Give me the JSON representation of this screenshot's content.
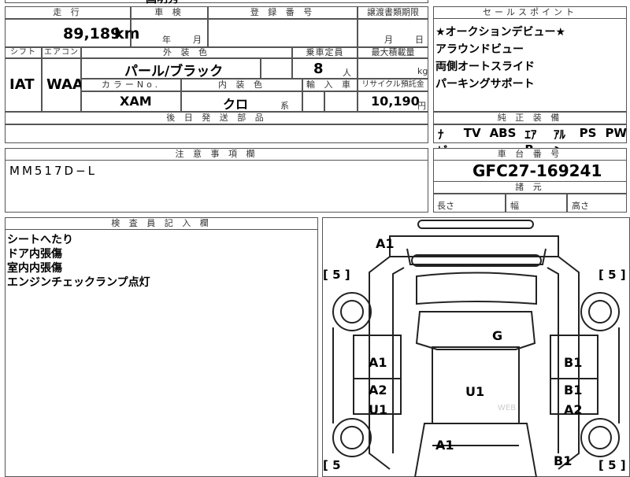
{
  "top_fragment": "国明秀",
  "headers": {
    "mileage": "走 行",
    "inspection": "車 検",
    "registration": "登 録 番 号",
    "transfer_deadline": "譲渡書類期限",
    "sales_point": "セールスポイント",
    "shift": "シフト",
    "aircon": "エアコン",
    "exterior": "外 装 色",
    "capacity": "乗車定員",
    "max_load": "最大積載量",
    "color_no": "カラーNo.",
    "interior": "内 装 色",
    "import": "輸 入 車",
    "recycle": "リサイクル預託金",
    "later_parts": "後 日 発 送 部 品",
    "options": "純 正 装 備",
    "notes": "注 意 事 項 欄",
    "chassis_no": "車 台 番 号",
    "dimensions": "諸 元",
    "inspector": "検 査 員 記 入 欄"
  },
  "values": {
    "mileage": "89,189",
    "mileage_unit": "km",
    "inspection_year": "年",
    "inspection_month": "月",
    "transfer_month": "月",
    "transfer_day": "日",
    "shift": "IAT",
    "aircon": "WAA",
    "exterior": "パール/ブラック",
    "capacity": "8",
    "capacity_unit": "人",
    "max_load_unit": "kg",
    "color_no": "XAM",
    "interior": "クロ",
    "interior_suffix": "系",
    "recycle": "10,190",
    "recycle_unit": "円",
    "notes": "MM517D−L",
    "chassis_no": "GFC27-169241",
    "length": "長さ",
    "width": "幅",
    "height": "高さ"
  },
  "sales_points": [
    "★オークションデビュー★",
    "アラウンドビュー",
    "両側オートスライド",
    "パーキングサポート"
  ],
  "options": [
    "ﾅﾋﾞ",
    "TV",
    "ABS",
    "ｴｱB",
    "ｱﾙﾐ",
    "PS",
    "PW"
  ],
  "inspector_notes": [
    "シートへたり",
    "ドア内張傷",
    "室内内張傷",
    "エンジンチェックランプ点灯"
  ],
  "diagram": {
    "labels": [
      "A1",
      "G",
      "A1",
      "B1",
      "A2",
      "B1",
      "U1",
      "U1",
      "A2",
      "A1",
      "B1"
    ],
    "tire_left_top": "[ 5 ]",
    "tire_right_top": "[ 5 ]",
    "tire_left_bottom": "[ 5",
    "tire_right_bottom": "[ 5 ]",
    "watermark": "WEB"
  }
}
